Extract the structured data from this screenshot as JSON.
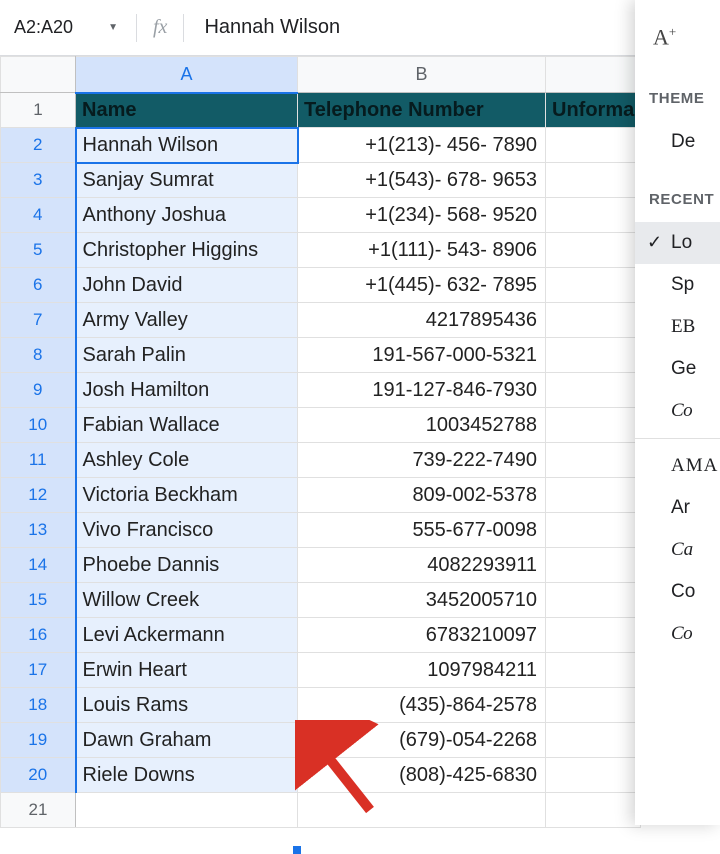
{
  "namebox": {
    "range": "A2:A20"
  },
  "formula": {
    "fx": "fx",
    "value": "Hannah Wilson"
  },
  "columns": {
    "A": "A",
    "B": "B",
    "C": ""
  },
  "header_row": {
    "A": "Name",
    "B": "Telephone Number",
    "C": "Unforma"
  },
  "rows": [
    {
      "n": "1"
    },
    {
      "n": "2",
      "A": "Hannah Wilson",
      "B": "+1(213)- 456- 7890"
    },
    {
      "n": "3",
      "A": "Sanjay Sumrat",
      "B": "+1(543)- 678- 9653"
    },
    {
      "n": "4",
      "A": "Anthony Joshua",
      "B": "+1(234)- 568- 9520"
    },
    {
      "n": "5",
      "A": "Christopher Higgins",
      "B": "+1(111)- 543- 8906"
    },
    {
      "n": "6",
      "A": "John David",
      "B": "+1(445)- 632- 7895"
    },
    {
      "n": "7",
      "A": "Army Valley",
      "B": "4217895436"
    },
    {
      "n": "8",
      "A": "Sarah Palin",
      "B": "191-567-000-5321"
    },
    {
      "n": "9",
      "A": "Josh Hamilton",
      "B": "191-127-846-7930"
    },
    {
      "n": "10",
      "A": "Fabian Wallace",
      "B": "1003452788"
    },
    {
      "n": "11",
      "A": "Ashley Cole",
      "B": "739-222-7490"
    },
    {
      "n": "12",
      "A": "Victoria Beckham",
      "B": "809-002-5378"
    },
    {
      "n": "13",
      "A": "Vivo Francisco",
      "B": "555-677-0098"
    },
    {
      "n": "14",
      "A": "Phoebe Dannis",
      "B": "4082293911"
    },
    {
      "n": "15",
      "A": "Willow Creek",
      "B": "3452005710"
    },
    {
      "n": "16",
      "A": "Levi Ackermann",
      "B": "6783210097"
    },
    {
      "n": "17",
      "A": "Erwin Heart",
      "B": "1097984211"
    },
    {
      "n": "18",
      "A": "Louis Rams",
      "B": "(435)-864-2578"
    },
    {
      "n": "19",
      "A": "Dawn Graham",
      "B": "(679)-054-2268"
    },
    {
      "n": "20",
      "A": "Riele Downs",
      "B": "(808)-425-6830"
    },
    {
      "n": "21",
      "A": "",
      "B": ""
    }
  ],
  "panel": {
    "icon_main": "A",
    "icon_plus": "+",
    "section_theme": "THEME",
    "theme_item": "De",
    "section_recent": "RECENT",
    "items": [
      {
        "label": "Lo",
        "selected": true
      },
      {
        "label": "Sp"
      },
      {
        "label": "EB"
      },
      {
        "label": "Ge"
      },
      {
        "label": "Co"
      },
      {
        "label": "AMA"
      },
      {
        "label": "Ar"
      },
      {
        "label": "Ca"
      },
      {
        "label": "Co"
      },
      {
        "label": "Co"
      }
    ]
  }
}
